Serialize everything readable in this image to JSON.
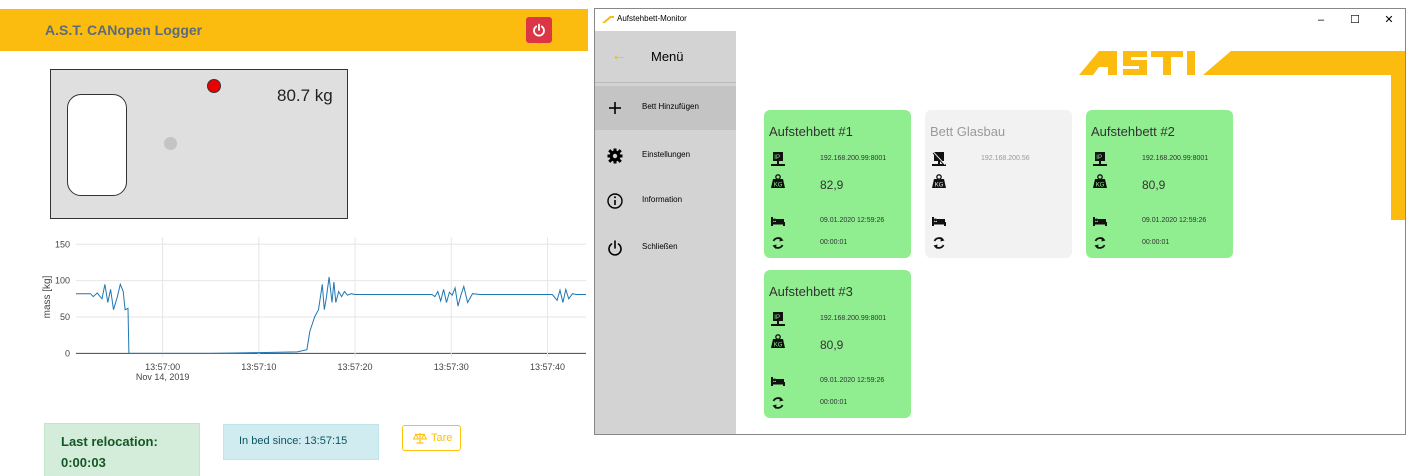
{
  "logger": {
    "title": "A.S.T. CANopen Logger",
    "weight": "80.7 kg",
    "chart_data": {
      "type": "line",
      "ylabel": "mass [kg]",
      "xlabel": "",
      "ylim": [
        -5,
        160
      ],
      "yticks": [
        0,
        50,
        100,
        150
      ],
      "xticks": [
        "13:57:00\nNov 14, 2019",
        "13:57:10",
        "13:57:20",
        "13:57:30",
        "13:57:40"
      ],
      "xtick_seconds": [
        0,
        10,
        20,
        30,
        40
      ],
      "xlim": [
        -9,
        44
      ],
      "grid": true,
      "series": [
        {
          "color": "#1f77b4",
          "x": [
            -9,
            -7.5,
            -7.2,
            -6.8,
            -6.3,
            -6.0,
            -5.7,
            -5.4,
            -5.1,
            -4.7,
            -4.4,
            -4.1,
            -3.9,
            -3.6,
            -3.5,
            -3.0,
            0,
            5,
            10,
            14,
            15,
            15.3,
            15.8,
            16.2,
            16.6,
            16.8,
            17.0,
            17.3,
            17.6,
            17.8,
            18.0,
            18.3,
            18.6,
            18.9,
            19.2,
            19.6,
            20,
            22,
            26,
            28,
            28.3,
            28.6,
            28.9,
            29.2,
            29.5,
            29.8,
            30.1,
            30.4,
            30.7,
            31.0,
            31.3,
            31.7,
            32.2,
            33,
            36,
            39,
            40.5,
            41.0,
            41.3,
            41.6,
            41.9,
            42.2,
            42.6,
            43,
            44
          ],
          "y": [
            82,
            82,
            78,
            83,
            75,
            95,
            70,
            88,
            60,
            78,
            95,
            85,
            60,
            62,
            0,
            0,
            0,
            0,
            1,
            2,
            5,
            30,
            50,
            60,
            95,
            60,
            75,
            105,
            70,
            98,
            70,
            85,
            78,
            85,
            80,
            82,
            81,
            81,
            81,
            81,
            78,
            85,
            72,
            88,
            70,
            84,
            80,
            90,
            65,
            80,
            92,
            70,
            82,
            81,
            81,
            81,
            81,
            73,
            87,
            70,
            88,
            75,
            82,
            81,
            81
          ]
        }
      ]
    },
    "last_relocation_label": "Last relocation:",
    "last_relocation_value": "0:00:03",
    "in_bed": "In bed since: 13:57:15",
    "tare_label": "Tare",
    "colors": {
      "header": "#fbbc0f",
      "power": "#dc3545"
    }
  },
  "monitor": {
    "window_title": "Aufstehbett-Monitor",
    "controls": [
      "–",
      "☐",
      "✕"
    ],
    "menu": {
      "title": "Menü",
      "items": [
        {
          "label": "Bett Hinzufügen",
          "icon": "plus-icon"
        },
        {
          "label": "Einstellungen",
          "icon": "gear-icon"
        },
        {
          "label": "Information",
          "icon": "info-icon"
        },
        {
          "label": "Schließen",
          "icon": "power-icon"
        }
      ]
    },
    "logo_text": "ASTI",
    "cards": [
      {
        "title": "Aufstehbett #1",
        "ip": "192.168.200.99:8001",
        "weight": "82,9",
        "date": "09.01.2020 12:59:26",
        "timer": "00:00:01",
        "state": "on"
      },
      {
        "title": "Bett Glasbau",
        "ip": "192.168.200.56",
        "weight": "",
        "date": "",
        "timer": "",
        "state": "off"
      },
      {
        "title": "Aufstehbett #2",
        "ip": "192.168.200.99:8001",
        "weight": "80,9",
        "date": "09.01.2020 12:59:26",
        "timer": "00:00:01",
        "state": "on"
      },
      {
        "title": "Aufstehbett #3",
        "ip": "192.168.200.99:8001",
        "weight": "80,9",
        "date": "09.01.2020 12:59:26",
        "timer": "00:00:01",
        "state": "on"
      }
    ],
    "colors": {
      "card_on": "#90ee90",
      "card_off": "#f2f2f2",
      "accent": "#fbbc0f"
    }
  }
}
